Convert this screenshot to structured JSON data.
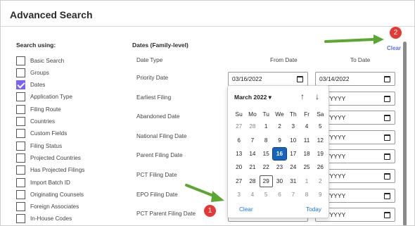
{
  "header": {
    "title": "Advanced Search"
  },
  "search_using": {
    "heading": "Search using:",
    "options": [
      {
        "label": "Basic Search",
        "checked": false
      },
      {
        "label": "Groups",
        "checked": false
      },
      {
        "label": "Dates",
        "checked": true
      },
      {
        "label": "Application Type",
        "checked": false
      },
      {
        "label": "Filing Route",
        "checked": false
      },
      {
        "label": "Countries",
        "checked": false
      },
      {
        "label": "Custom Fields",
        "checked": false
      },
      {
        "label": "Filing Status",
        "checked": false
      },
      {
        "label": "Projected Countries",
        "checked": false
      },
      {
        "label": "Has Projected Filings",
        "checked": false
      },
      {
        "label": "Import Batch ID",
        "checked": false
      },
      {
        "label": "Originating Counsels",
        "checked": false
      },
      {
        "label": "Foreign Associates",
        "checked": false
      },
      {
        "label": "In-House Codes",
        "checked": false
      }
    ]
  },
  "dates": {
    "heading": "Dates (Family-level)",
    "clear_label": "Clear",
    "col_type": "Date Type",
    "col_from": "From Date",
    "col_to": "To Date",
    "rows": [
      {
        "label": "Priority Date",
        "from": "03/16/2022",
        "to": "03/14/2022"
      },
      {
        "label": "Earliest Filing",
        "from": "",
        "to": "DD/YYYY"
      },
      {
        "label": "Abandoned Date",
        "from": "",
        "to": "DD/YYYY"
      },
      {
        "label": "National Filing Date",
        "from": "",
        "to": "DD/YYYY"
      },
      {
        "label": "Parent Filing Date",
        "from": "",
        "to": "DD/YYYY"
      },
      {
        "label": "PCT Filing Date",
        "from": "",
        "to": "DD/YYYY"
      },
      {
        "label": "EPO Filing Date",
        "from": "",
        "to": "DD/YYYY"
      },
      {
        "label": "PCT Parent Filing Date",
        "from": "",
        "to": "DD/YYYY"
      }
    ]
  },
  "datepicker": {
    "month_label": "March 2022 ▾",
    "up_icon": "arrow-up-icon",
    "down_icon": "arrow-down-icon",
    "weekdays": [
      "Su",
      "Mo",
      "Tu",
      "We",
      "Th",
      "Fr",
      "Sa"
    ],
    "weeks": [
      [
        "27",
        "28",
        "1",
        "2",
        "3",
        "4",
        "5"
      ],
      [
        "6",
        "7",
        "8",
        "9",
        "10",
        "11",
        "12"
      ],
      [
        "13",
        "14",
        "15",
        "16",
        "17",
        "18",
        "19"
      ],
      [
        "20",
        "21",
        "22",
        "23",
        "24",
        "25",
        "26"
      ],
      [
        "27",
        "28",
        "29",
        "30",
        "31",
        "1",
        "2"
      ],
      [
        "3",
        "4",
        "5",
        "6",
        "7",
        "8",
        "9"
      ]
    ],
    "selected": "16",
    "today": "29",
    "clear_label": "Clear",
    "today_label": "Today"
  },
  "annotations": {
    "badge1": "1",
    "badge2": "2",
    "accent": "#7b61ff",
    "arrow_color": "#5aa832",
    "badge_color": "#e53935"
  }
}
